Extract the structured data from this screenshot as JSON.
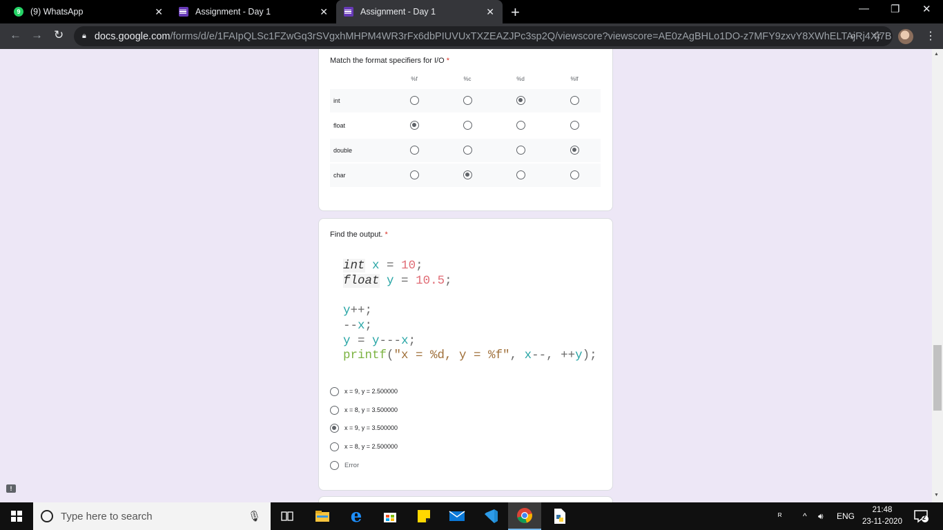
{
  "browser": {
    "tabs": [
      {
        "title": "(9) WhatsApp",
        "badge": "9",
        "icon": "whatsapp-icon",
        "active": false
      },
      {
        "title": "Assignment - Day 1",
        "icon": "google-forms-icon",
        "active": false
      },
      {
        "title": "Assignment - Day 1",
        "icon": "google-forms-icon",
        "active": true
      }
    ],
    "url_host": "docs.google.com",
    "url_path": "/forms/d/e/1FAIpQLSc1FZwGq3rSVgxhMHPM4WR3rFx6dbPIUVUxTXZEAZJPc3sp2Q/viewscore?viewscore=AE0zAgBHLo1DO-z7MFY9zxvY8XWhELTAjRj4Xj7B..."
  },
  "form": {
    "q1": {
      "title": "Match the format specifiers for I/O",
      "required_mark": "*",
      "columns": [
        "%f",
        "%c",
        "%d",
        "%lf"
      ],
      "rows": [
        {
          "label": "int",
          "selected": 2
        },
        {
          "label": "float",
          "selected": 0
        },
        {
          "label": "double",
          "selected": 3
        },
        {
          "label": "char",
          "selected": 1
        }
      ]
    },
    "q2": {
      "title": "Find the output.",
      "required_mark": "*",
      "code": {
        "l1_kw": "int",
        "l1_var": "x",
        "l1_eq": " = ",
        "l1_num": "10",
        "l1_end": ";",
        "l2_kw": "float",
        "l2_var": "y",
        "l2_eq": " = ",
        "l2_num": "10.5",
        "l2_end": ";",
        "l4_var": "y",
        "l4_rest": "++;",
        "l5_pre": "--",
        "l5_var": "x",
        "l5_end": ";",
        "l6_var1": "y",
        "l6_mid": " = ",
        "l6_var2": "y",
        "l6_op": "---",
        "l6_var3": "x",
        "l6_end": ";",
        "l7_fn": "printf",
        "l7_open": "(",
        "l7_str": "\"x = %d, y = %f\"",
        "l7_comma1": ", ",
        "l7_var1": "x",
        "l7_dec": "--",
        "l7_comma2": ", ",
        "l7_inc": "++",
        "l7_var2": "y",
        "l7_end": ");"
      },
      "options": [
        {
          "label": "x = 9, y = 2.500000",
          "selected": false
        },
        {
          "label": "x = 8, y = 3.500000",
          "selected": false
        },
        {
          "label": "x = 9, y = 3.500000",
          "selected": true
        },
        {
          "label": "x = 8, y = 2.500000",
          "selected": false
        },
        {
          "label": "Error",
          "selected": false
        }
      ]
    }
  },
  "taskbar": {
    "search_placeholder": "Type here to search",
    "language": "ENG",
    "time": "21:48",
    "date": "23-11-2020",
    "notifications": "2"
  },
  "colors": {
    "page_bg": "#ede7f6",
    "forms_purple": "#673ab7",
    "required_red": "#d93025",
    "active_app_underline": "#76b9ed"
  }
}
